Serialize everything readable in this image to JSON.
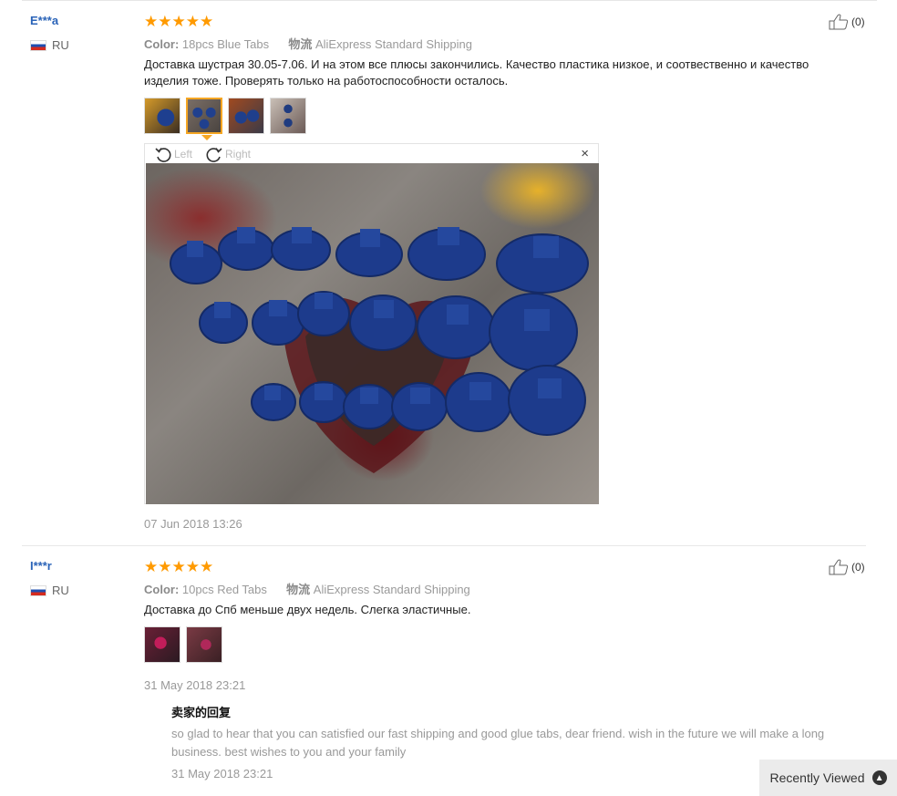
{
  "reviews": [
    {
      "user": "E***a",
      "country": "RU",
      "stars": "★★★★★",
      "color_label": "Color:",
      "color_value": "18pcs Blue Tabs",
      "shipping_label": "物流",
      "shipping_value": "AliExpress Standard Shipping",
      "text": "Доставка шустрая 30.05-7.06. И на этом все плюсы закончились. Качество пластика низкое, и соотвественно и качество изделия тоже. Проверять только на работоспособности осталось.",
      "helpful_count": "(0)",
      "date": "07 Jun 2018 13:26",
      "viewer": {
        "left_label": "Left",
        "right_label": "Right",
        "close": "×"
      }
    },
    {
      "user": "I***r",
      "country": "RU",
      "stars": "★★★★★",
      "color_label": "Color:",
      "color_value": "10pcs Red Tabs",
      "shipping_label": "物流",
      "shipping_value": "AliExpress Standard Shipping",
      "text": "Доставка до Спб меньше двух недель. Слегка эластичные.",
      "helpful_count": "(0)",
      "date": "31 May 2018 23:21",
      "reply": {
        "title": "卖家的回复",
        "text": "so glad to hear that you can satisfied our fast shipping and good glue tabs, dear friend. wish in the future we will make a long business. best wishes to you and your family",
        "date": "31 May 2018 23:21"
      }
    }
  ],
  "recently_viewed": {
    "label": "Recently Viewed",
    "icon": "chevron-up-icon"
  },
  "colors": {
    "accent_star": "#ff9a00",
    "user_link": "#2a63b8",
    "active_thumb": "#f5a623"
  }
}
